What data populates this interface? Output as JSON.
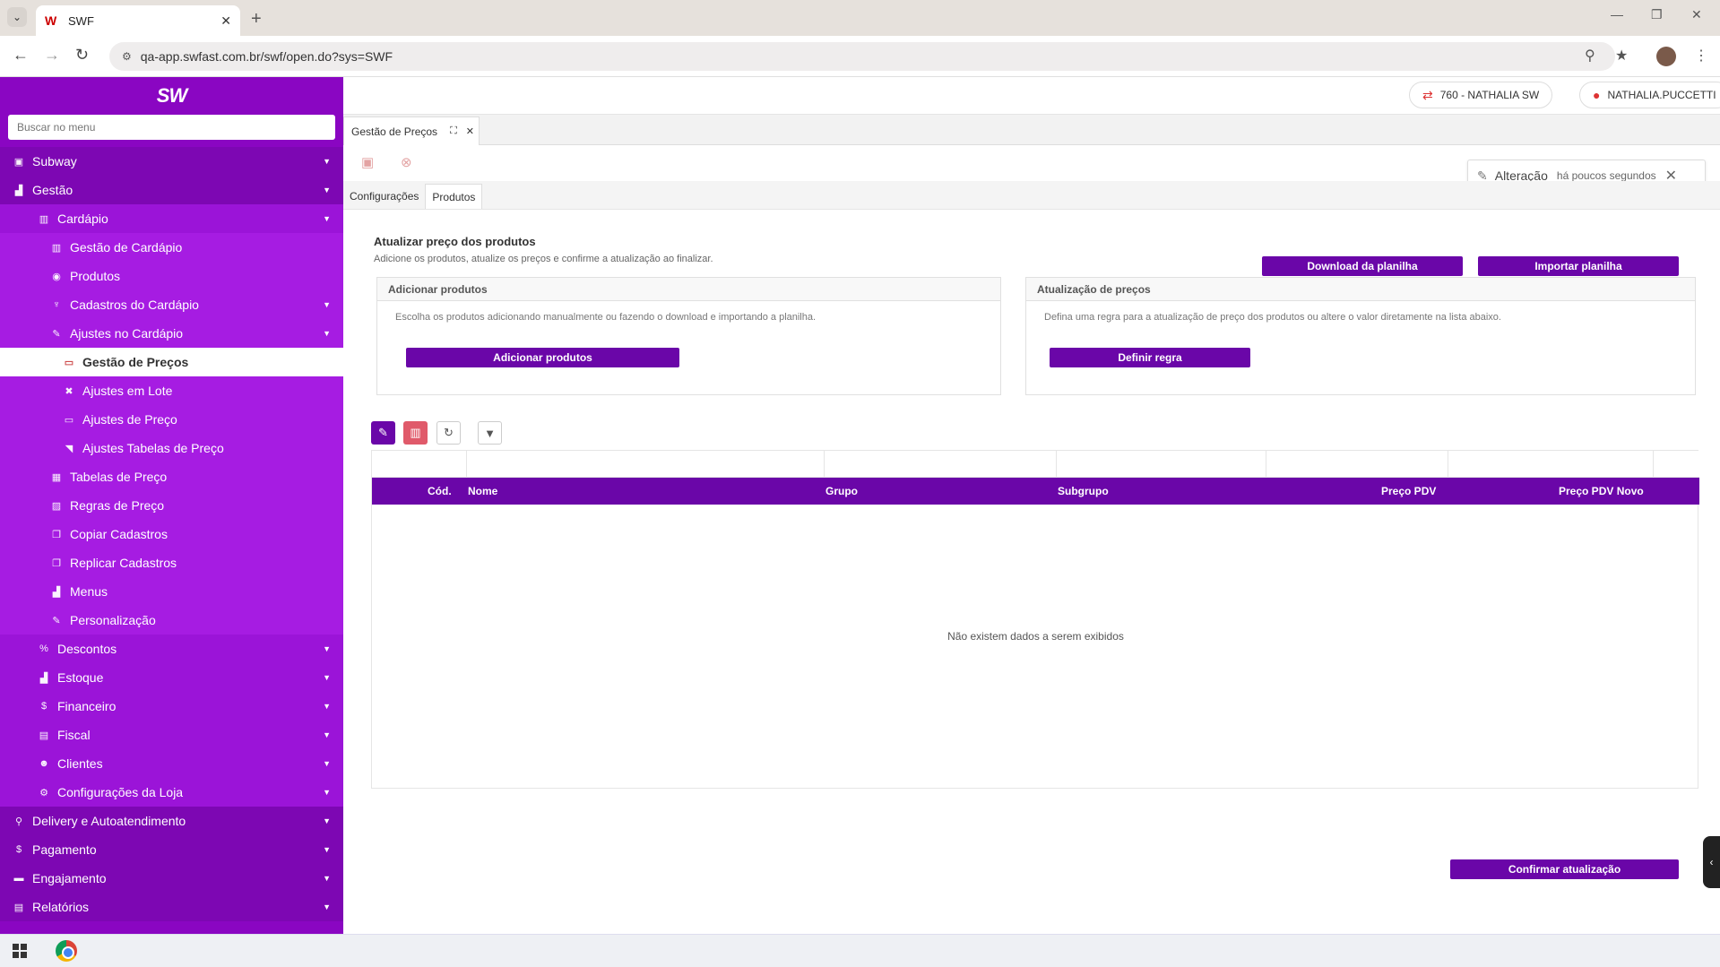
{
  "browser": {
    "tab_title": "SWF",
    "url": "qa-app.swfast.com.br/swf/open.do?sys=SWF"
  },
  "sidebar": {
    "logo": "SW",
    "search_placeholder": "Buscar no menu",
    "items": [
      {
        "label": "Subway"
      },
      {
        "label": "Gestão"
      },
      {
        "label": "Cardápio"
      },
      {
        "label": "Gestão de Cardápio"
      },
      {
        "label": "Produtos"
      },
      {
        "label": "Cadastros do Cardápio"
      },
      {
        "label": "Ajustes no Cardápio"
      },
      {
        "label": "Gestão de Preços"
      },
      {
        "label": "Ajustes em Lote"
      },
      {
        "label": "Ajustes de Preço"
      },
      {
        "label": "Ajustes Tabelas de Preço"
      },
      {
        "label": "Tabelas de Preço"
      },
      {
        "label": "Regras de Preço"
      },
      {
        "label": "Copiar Cadastros"
      },
      {
        "label": "Replicar Cadastros"
      },
      {
        "label": "Menus"
      },
      {
        "label": "Personalização"
      },
      {
        "label": "Descontos"
      },
      {
        "label": "Estoque"
      },
      {
        "label": "Financeiro"
      },
      {
        "label": "Fiscal"
      },
      {
        "label": "Clientes"
      },
      {
        "label": "Configurações da Loja"
      },
      {
        "label": "Delivery e Autoatendimento"
      },
      {
        "label": "Pagamento"
      },
      {
        "label": "Engajamento"
      },
      {
        "label": "Relatórios"
      }
    ]
  },
  "topbar": {
    "store": "760 - NATHALIA SW",
    "user": "NATHALIA.PUCCETTI"
  },
  "page_tab": {
    "label": "Gestão de Preços"
  },
  "notification": {
    "title": "Alteração",
    "time": "há poucos segundos"
  },
  "subtabs": [
    "Configurações",
    "Produtos"
  ],
  "content": {
    "title": "Atualizar preço dos produtos",
    "subtitle": "Adicione os produtos, atualize os preços e confirme a atualização ao finalizar.",
    "download_btn": "Download da planilha",
    "import_btn": "Importar planilha",
    "panel_add": {
      "title": "Adicionar produtos",
      "desc": "Escolha os produtos adicionando manualmente ou fazendo o download e importando a planilha.",
      "button": "Adicionar produtos"
    },
    "panel_update": {
      "title": "Atualização de preços",
      "desc": "Defina uma regra para a atualização de preço dos produtos ou altere o valor diretamente na lista abaixo.",
      "button": "Definir regra"
    },
    "table": {
      "columns": [
        "Cód.",
        "Nome",
        "Grupo",
        "Subgrupo",
        "Preço PDV",
        "Preço PDV Novo"
      ],
      "empty": "Não existem dados a serem exibidos"
    },
    "confirm_btn": "Confirmar atualização"
  },
  "colors": {
    "sidebar": "#8a06c2",
    "accent": "#6a06a8",
    "delete": "#e05a6a"
  }
}
